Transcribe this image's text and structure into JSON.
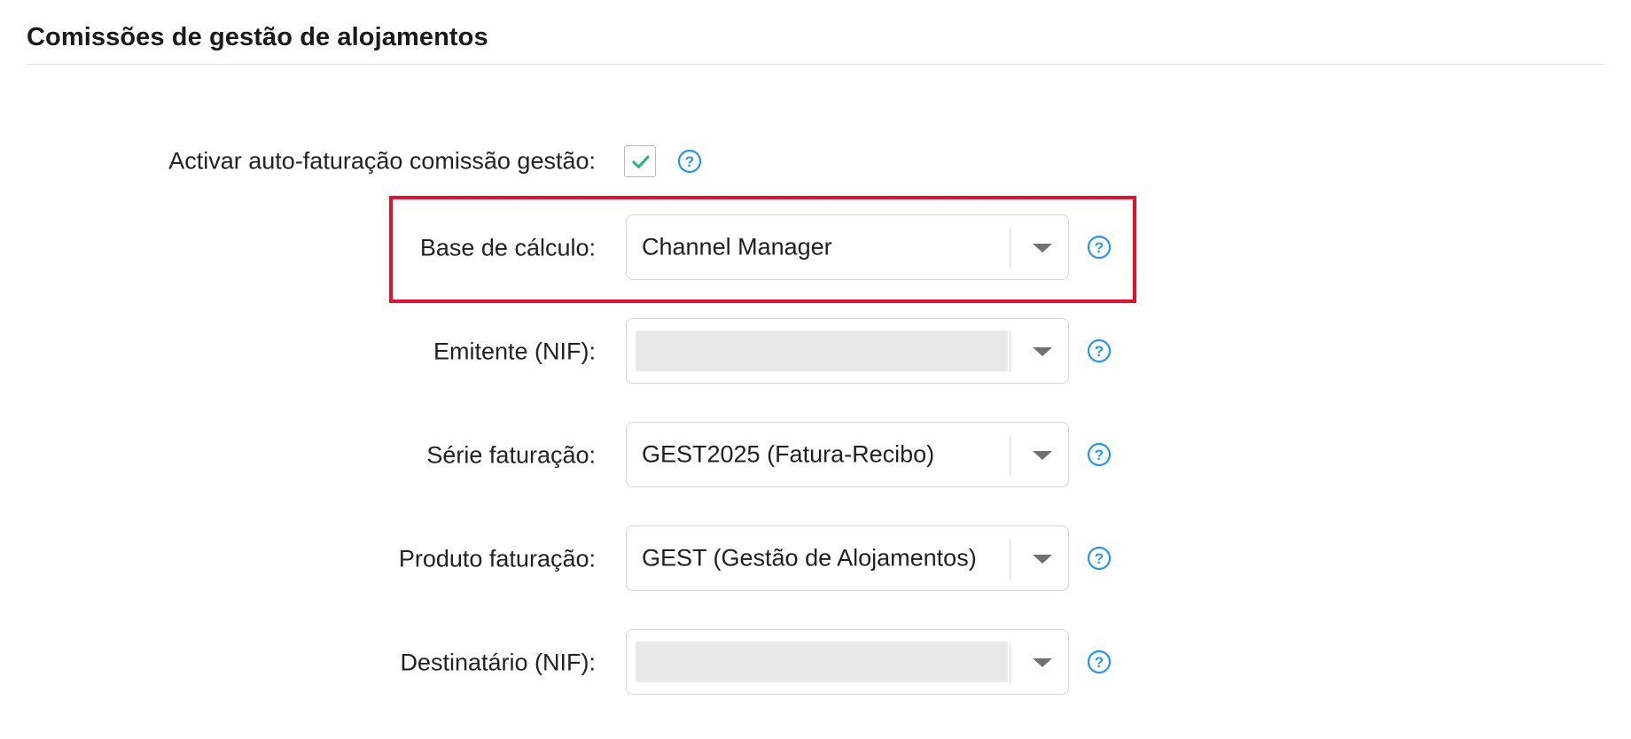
{
  "section": {
    "title": "Comissões de gestão de alojamentos"
  },
  "auto_billing": {
    "label": "Activar auto-faturação comissão gestão:",
    "checked": true,
    "help_icon": "question-circle-icon"
  },
  "fields": [
    {
      "label": "Base de cálculo:",
      "value": "Channel Manager",
      "help_icon": "question-circle-icon"
    },
    {
      "label": "Emitente (NIF):",
      "value": "",
      "help_icon": "question-circle-icon"
    },
    {
      "label": "Série faturação:",
      "value": "GEST2025 (Fatura-Recibo)",
      "help_icon": "question-circle-icon"
    },
    {
      "label": "Produto faturação:",
      "value": "GEST (Gestão de Alojamentos)",
      "help_icon": "question-circle-icon"
    },
    {
      "label": "Destinatário (NIF):",
      "value": "",
      "help_icon": "question-circle-icon"
    }
  ],
  "colors": {
    "accent_help": "#2196f3",
    "check": "#22b573",
    "highlight": "#e8112d"
  }
}
